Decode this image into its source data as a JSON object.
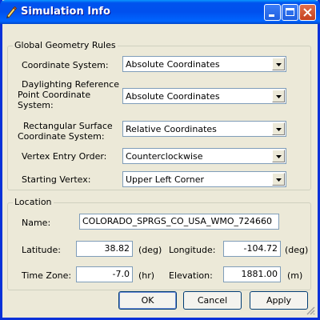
{
  "window": {
    "title": "Simulation Info",
    "icon": "pencil-icon",
    "controls": [
      "minimize-icon",
      "maximize-icon",
      "close-icon"
    ]
  },
  "geometry": {
    "legend": "Global Geometry Rules",
    "coordinate_system": {
      "label": "Coordinate System:",
      "value": "Absolute Coordinates"
    },
    "daylighting": {
      "label_lines": [
        "Daylighting Reference",
        "Point Coordinate",
        "System:"
      ],
      "value": "Absolute Coordinates"
    },
    "rect_surface": {
      "label_lines": [
        "Rectangular Surface",
        "Coordinate System:"
      ],
      "value": "Relative Coordinates"
    },
    "vertex_order": {
      "label": "Vertex Entry Order:",
      "value": "Counterclockwise"
    },
    "starting_vertex": {
      "label": "Starting Vertex:",
      "value": "Upper Left Corner"
    }
  },
  "location": {
    "legend": "Location",
    "name_label": "Name:",
    "name_value": "COLORADO_SPRGS_CO_USA_WMO_724660",
    "latitude_label": "Latitude:",
    "latitude_value": "38.82",
    "latitude_unit": "(deg)",
    "longitude_label": "Longitude:",
    "longitude_value": "-104.72",
    "longitude_unit": "(deg)",
    "timezone_label": "Time Zone:",
    "timezone_value": "-7.0",
    "timezone_unit": "(hr)",
    "elevation_label": "Elevation:",
    "elevation_value": "1881.00",
    "elevation_unit": "(m)"
  },
  "buttons": {
    "ok": "OK",
    "cancel": "Cancel",
    "apply": "Apply"
  },
  "colors": {
    "title_bar": "#0054e3",
    "window_border": "#0831d9",
    "face": "#ece9d8",
    "close_button": "#c5401f"
  }
}
